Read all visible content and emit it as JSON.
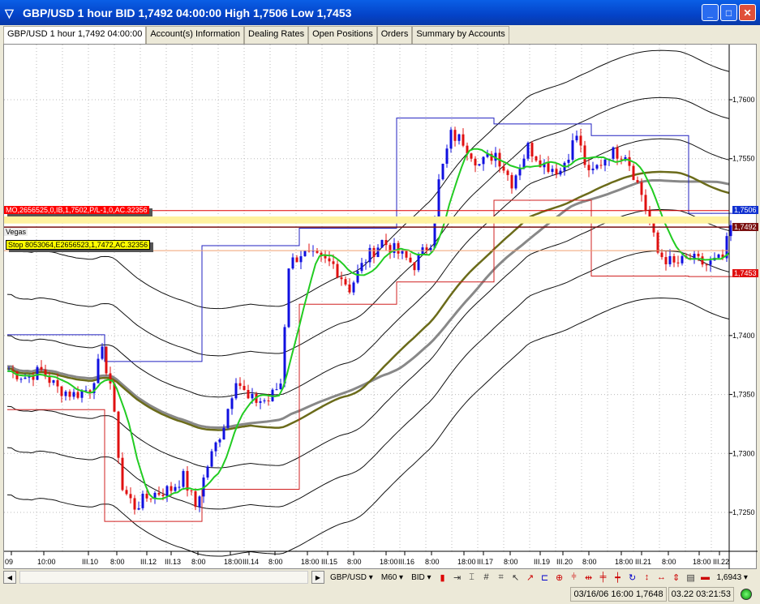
{
  "window": {
    "title": "GBP/USD 1 hour BID 1,7492 04:00:00 High 1,7506 Low 1,7453",
    "buttons": [
      "_",
      "□",
      "✕"
    ]
  },
  "tabs": [
    "GBP/USD 1 hour 1,7492 04:00:00",
    "Account(s) Information",
    "Dealing Rates",
    "Open Positions",
    "Orders",
    "Summary by Accounts"
  ],
  "chart": {
    "order_label": "MO,2656525,0,IB,1,7502,P/L-1,0,AC.32356",
    "indicator_label": "Vegas",
    "stop_label": "Stop 8053064,E2656523,1,7472,AC.32356",
    "price_tags": {
      "high": "1,7506",
      "current": "1,7492",
      "low": "1,7453"
    },
    "colors": {
      "up": "#1010e0",
      "down": "#e01010",
      "ma_fast": "#22cc22",
      "ma_olive": "#6b6b1a",
      "ma_grey": "#888888",
      "channel_high": "#2020c0",
      "channel_low": "#d02020",
      "order": "#e00000",
      "stop": "#ffff00"
    }
  },
  "chart_data": {
    "type": "candlestick",
    "symbol": "GBP/USD",
    "timeframe": "1 hour",
    "ylim": [
      1.721,
      1.768
    ],
    "y_ticks": [
      "1,7600",
      "1,7550",
      "1,7400",
      "1,7350",
      "1,7300",
      "1,7250"
    ],
    "y_tick_values": [
      1.76,
      1.755,
      1.74,
      1.735,
      1.73,
      1.725
    ],
    "x_ticks": [
      "09",
      "10:00",
      "III.10",
      "8:00",
      "III.12",
      "III.13",
      "8:00",
      "18:00",
      "III.14",
      "8:00",
      "18:00",
      "III.15",
      "8:00",
      "18:00",
      "III.16",
      "8:00",
      "18:00",
      "III.17",
      "8:00",
      "III.19",
      "III.20",
      "8:00",
      "18:00",
      "III.21",
      "8:00",
      "18:00",
      "III.22"
    ],
    "close_anchors": [
      [
        0,
        1.737
      ],
      [
        4,
        1.7365
      ],
      [
        8,
        1.737
      ],
      [
        12,
        1.7355
      ],
      [
        16,
        1.735
      ],
      [
        20,
        1.7355
      ],
      [
        23,
        1.7385
      ],
      [
        25,
        1.736
      ],
      [
        28,
        1.727
      ],
      [
        31,
        1.7255
      ],
      [
        35,
        1.7265
      ],
      [
        40,
        1.727
      ],
      [
        43,
        1.728
      ],
      [
        46,
        1.7255
      ],
      [
        49,
        1.729
      ],
      [
        53,
        1.7325
      ],
      [
        56,
        1.7365
      ],
      [
        59,
        1.7345
      ],
      [
        64,
        1.7345
      ],
      [
        67,
        1.736
      ],
      [
        69,
        1.746
      ],
      [
        72,
        1.747
      ],
      [
        76,
        1.7465
      ],
      [
        80,
        1.746
      ],
      [
        84,
        1.744
      ],
      [
        88,
        1.7465
      ],
      [
        92,
        1.748
      ],
      [
        96,
        1.747
      ],
      [
        100,
        1.746
      ],
      [
        104,
        1.748
      ],
      [
        106,
        1.753
      ],
      [
        109,
        1.757
      ],
      [
        112,
        1.7565
      ],
      [
        116,
        1.7545
      ],
      [
        120,
        1.7555
      ],
      [
        124,
        1.753
      ],
      [
        128,
        1.756
      ],
      [
        132,
        1.7545
      ],
      [
        136,
        1.754
      ],
      [
        140,
        1.757
      ],
      [
        143,
        1.7535
      ],
      [
        148,
        1.7555
      ],
      [
        152,
        1.7555
      ],
      [
        156,
        1.752
      ],
      [
        160,
        1.747
      ],
      [
        164,
        1.746
      ],
      [
        168,
        1.7465
      ],
      [
        172,
        1.746
      ],
      [
        176,
        1.7465
      ],
      [
        178,
        1.7492
      ]
    ],
    "levels": {
      "order_entry": 1.7506,
      "yellow_band": [
        1.7495,
        1.7501
      ],
      "bid": 1.7492,
      "stop": 1.7472,
      "session_low": 1.7453
    }
  },
  "toolbar": {
    "symbol": "GBP/USD ▾",
    "period": "M60 ▾",
    "side": "BID ▾",
    "value": "1,6943 ▾"
  },
  "status": {
    "cursor_time": "03/16/06 16:00",
    "cursor_price": "1,7648",
    "server_time": "03.22 03:21:53"
  }
}
